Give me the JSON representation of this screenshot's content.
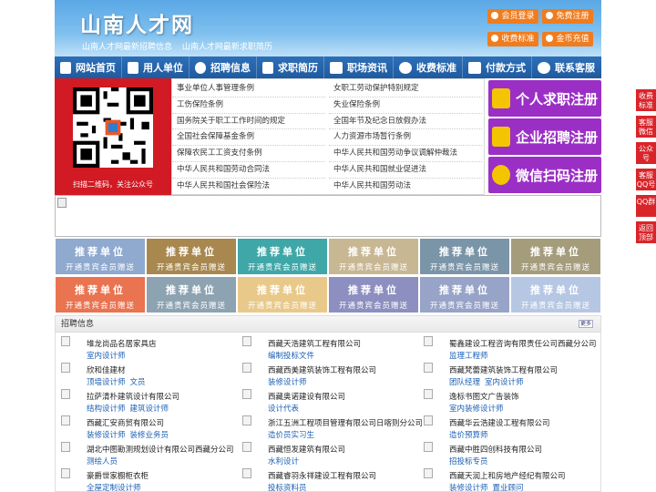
{
  "header": {
    "title": "山南人才网",
    "sub1": "山南人才网最新招聘信息",
    "sub2": "山南人才网最新求职简历",
    "buttons": [
      "会员登录",
      "免费注册",
      "收费标准",
      "金币充值"
    ]
  },
  "nav": [
    "网站首页",
    "用人单位",
    "招聘信息",
    "求职简历",
    "职场资讯",
    "收费标准",
    "付款方式",
    "联系客服"
  ],
  "qr": {
    "caption": "扫描二维码，关注公众号"
  },
  "links": {
    "left": [
      "事业单位人事管理条例",
      "工伤保险条例",
      "国务院关于职工工作时间的规定",
      "全国社会保障基金条例",
      "保障农民工工资支付条例",
      "中华人民共和国劳动合同法",
      "中华人民共和国社会保险法"
    ],
    "right": [
      "女职工劳动保护特别规定",
      "失业保险条例",
      "全国年节及纪念日放假办法",
      "人力资源市场暂行条例",
      "中华人民共和国劳动争议调解仲裁法",
      "中华人民共和国就业促进法",
      "中华人民共和国劳动法"
    ]
  },
  "register": [
    "个人求职注册",
    "企业招聘注册",
    "微信扫码注册"
  ],
  "recommend": {
    "title": "推荐单位",
    "sub": "开通贵宾会员赠送",
    "colors": [
      "#8fa9cf",
      "#a8884f",
      "#3fa7a8",
      "#c8b793",
      "#7b95a8",
      "#a59c7c",
      "#ea7350",
      "#8da3b1",
      "#e9c98a",
      "#8d8fc0",
      "#98a3c8",
      "#b6c7e3"
    ]
  },
  "jobs_section": {
    "title": "招聘信息",
    "more": "更多",
    "items": [
      {
        "company": "堆龙尚品名居家具店",
        "positions": [
          "室内设计师"
        ]
      },
      {
        "company": "西藏天浩建筑工程有限公司",
        "positions": [
          "编制投标文件"
        ]
      },
      {
        "company": "蜀鑫建设工程咨询有限责任公司西藏分公司",
        "positions": [
          "监理工程师"
        ]
      },
      {
        "company": "欣和佳建材",
        "positions": [
          "顶墙设计师",
          "文员"
        ]
      },
      {
        "company": "西藏西美建筑装饰工程有限公司",
        "positions": [
          "装修设计师"
        ]
      },
      {
        "company": "西藏梵蕾建筑装饰工程有限公司",
        "positions": [
          "团队经理",
          "室内设计师"
        ]
      },
      {
        "company": "拉萨清朴建筑设计有限公司",
        "positions": [
          "结构设计师",
          "建筑设计师"
        ]
      },
      {
        "company": "西藏奥诺建设有限公司",
        "positions": [
          "设计代表"
        ]
      },
      {
        "company": "逸标书图文广告装饰",
        "positions": [
          "室内装修设计师"
        ]
      },
      {
        "company": "西藏汇安商贸有限公司",
        "positions": [
          "装修设计师",
          "装修业务员"
        ]
      },
      {
        "company": "浙江五洲工程项目管理有限公司日喀则分公司",
        "positions": [
          "造价员实习生"
        ]
      },
      {
        "company": "西藏华云浩建设工程有限公司",
        "positions": [
          "造价预算师"
        ]
      },
      {
        "company": "湖北中图勘测规划设计有限公司西藏分公司",
        "positions": [
          "测绘人员"
        ]
      },
      {
        "company": "西藏恒发建筑有限公司",
        "positions": [
          "水利设计"
        ]
      },
      {
        "company": "西藏中胜四创科技有限公司",
        "positions": [
          "招投标专员"
        ]
      },
      {
        "company": "豪爵世家橱柜衣柜",
        "positions": [
          "全屋定制设计师"
        ]
      },
      {
        "company": "西藏睿羽永祥建设工程有限公司",
        "positions": [
          "投标资料员"
        ]
      },
      {
        "company": "西藏天润上和房地产经纪有限公司",
        "positions": [
          "装修设计师",
          "置业顾问"
        ]
      }
    ]
  },
  "sidebar": [
    "收费标准",
    "客服微信",
    "公众号",
    "客服QQ号",
    "QQ群",
    "返回顶部"
  ]
}
